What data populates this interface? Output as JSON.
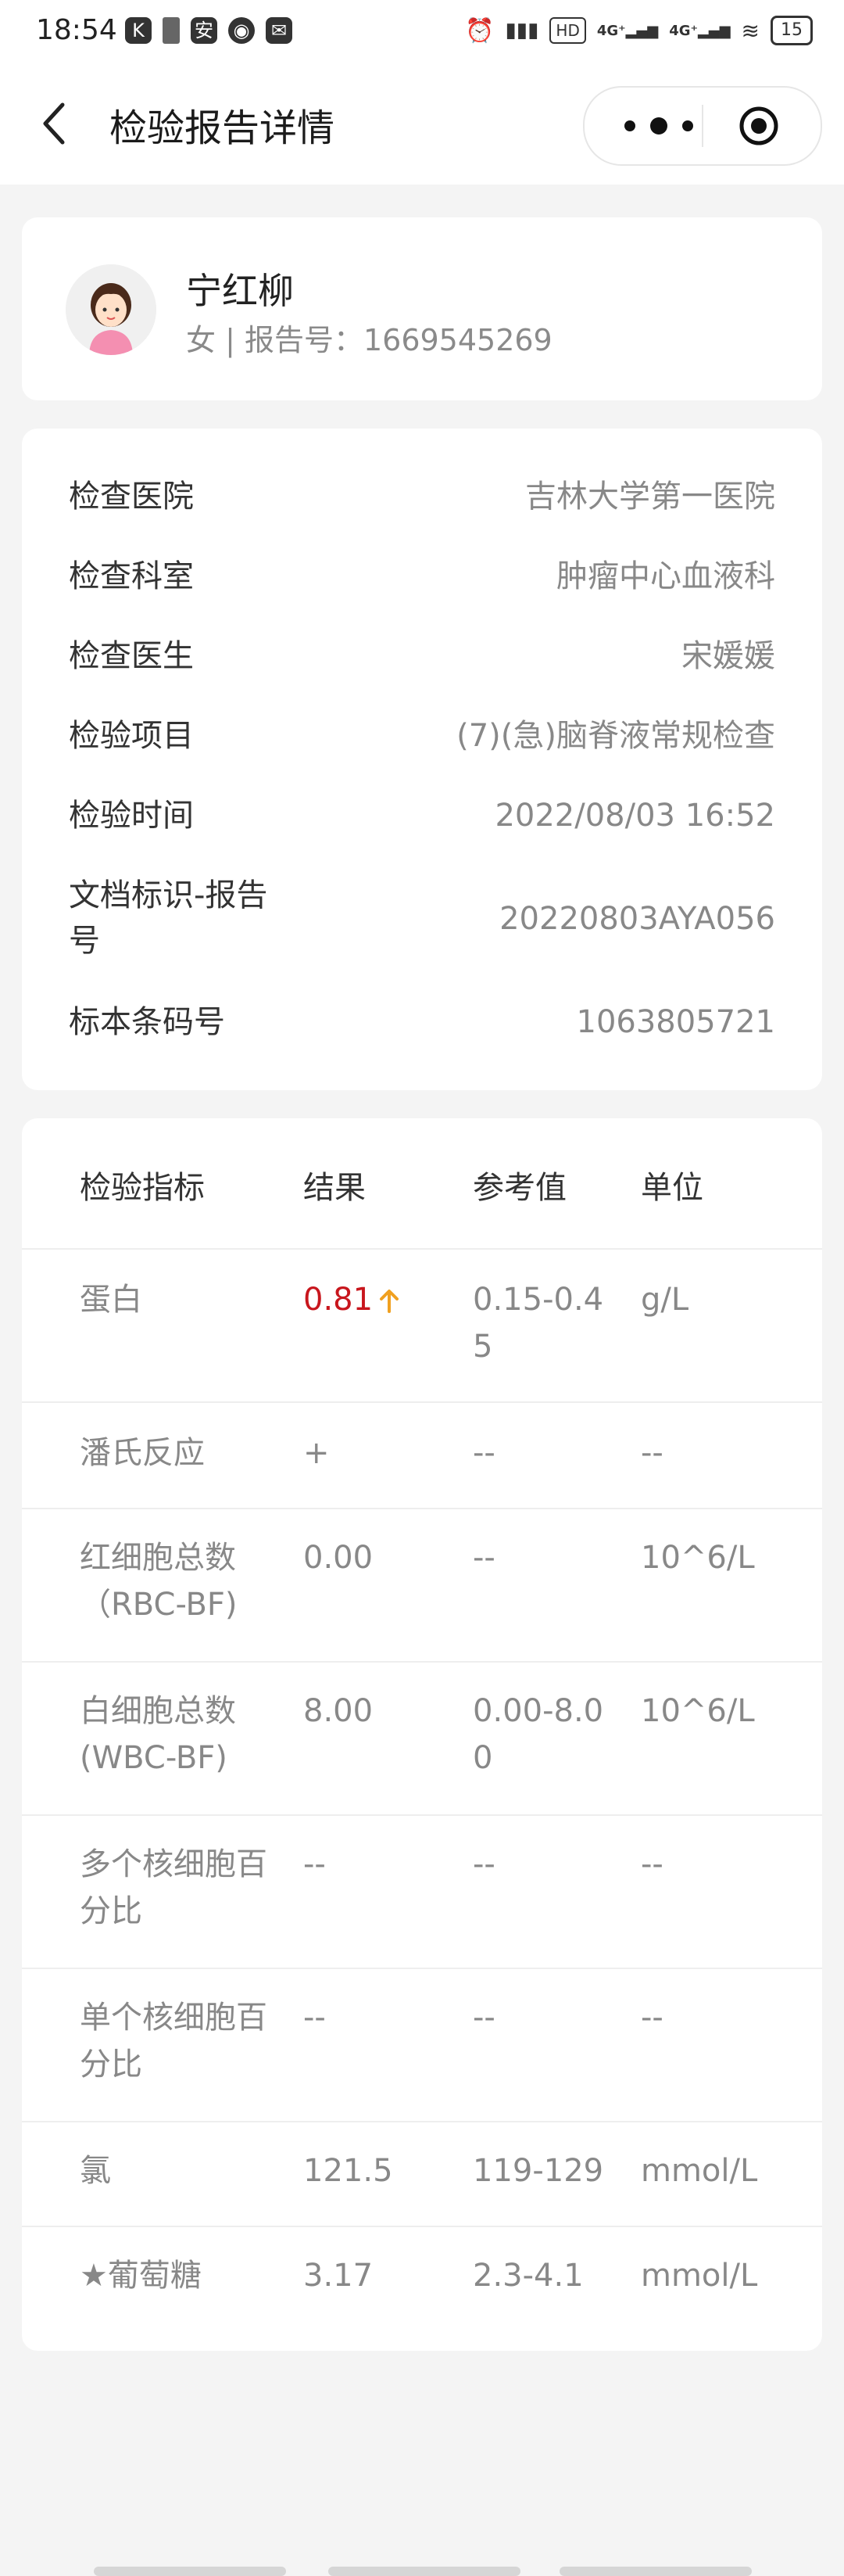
{
  "status_bar": {
    "time": "18:54",
    "battery": "15"
  },
  "header": {
    "title": "检验报告详情"
  },
  "patient": {
    "name": "宁红柳",
    "subtitle": "女 | 报告号：1669545269"
  },
  "info": [
    {
      "label": "检查医院",
      "value": "吉林大学第一医院"
    },
    {
      "label": "检查科室",
      "value": "肿瘤中心血液科"
    },
    {
      "label": "检查医生",
      "value": "宋媛媛"
    },
    {
      "label": "检验项目",
      "value": "(7)(急)脑脊液常规检查"
    },
    {
      "label": "检验时间",
      "value": "2022/08/03 16:52"
    },
    {
      "label_line1": "文档标识-报告",
      "label_line2": "号",
      "value": "20220803AYA056"
    },
    {
      "label": "标本条码号",
      "value": "1063805721"
    }
  ],
  "table": {
    "headers": [
      "检验指标",
      "结果",
      "参考值",
      "单位"
    ],
    "rows": [
      {
        "name1": "蛋白",
        "name2": "",
        "result": "0.81",
        "ref1": "0.15-0.4",
        "ref2": "5",
        "unit": "g/L",
        "high": true
      },
      {
        "name1": "潘氏反应",
        "name2": "",
        "result": "+",
        "ref1": "--",
        "ref2": "",
        "unit": "--"
      },
      {
        "name1": "红细胞总数",
        "name2": "（RBC-BF)",
        "result": "0.00",
        "ref1": "--",
        "ref2": "",
        "unit": "10^6/L"
      },
      {
        "name1": "白细胞总数",
        "name2": "(WBC-BF)",
        "result": "8.00",
        "ref1": "0.00-8.0",
        "ref2": "0",
        "unit": "10^6/L"
      },
      {
        "name1": "多个核细胞百",
        "name2": "分比",
        "result": "--",
        "ref1": "--",
        "ref2": "",
        "unit": "--"
      },
      {
        "name1": "单个核细胞百",
        "name2": "分比",
        "result": "--",
        "ref1": "--",
        "ref2": "",
        "unit": "--"
      },
      {
        "name1": "氯",
        "name2": "",
        "result": "121.5",
        "ref1": "119-129",
        "ref2": "",
        "unit": "mmol/L"
      },
      {
        "name1": "★葡萄糖",
        "name2": "",
        "result": "3.17",
        "ref1": "2.3-4.1",
        "ref2": "",
        "unit": "mmol/L"
      }
    ]
  },
  "colors": {
    "high_value": "#c8161d",
    "up_arrow": "#f0a020"
  }
}
